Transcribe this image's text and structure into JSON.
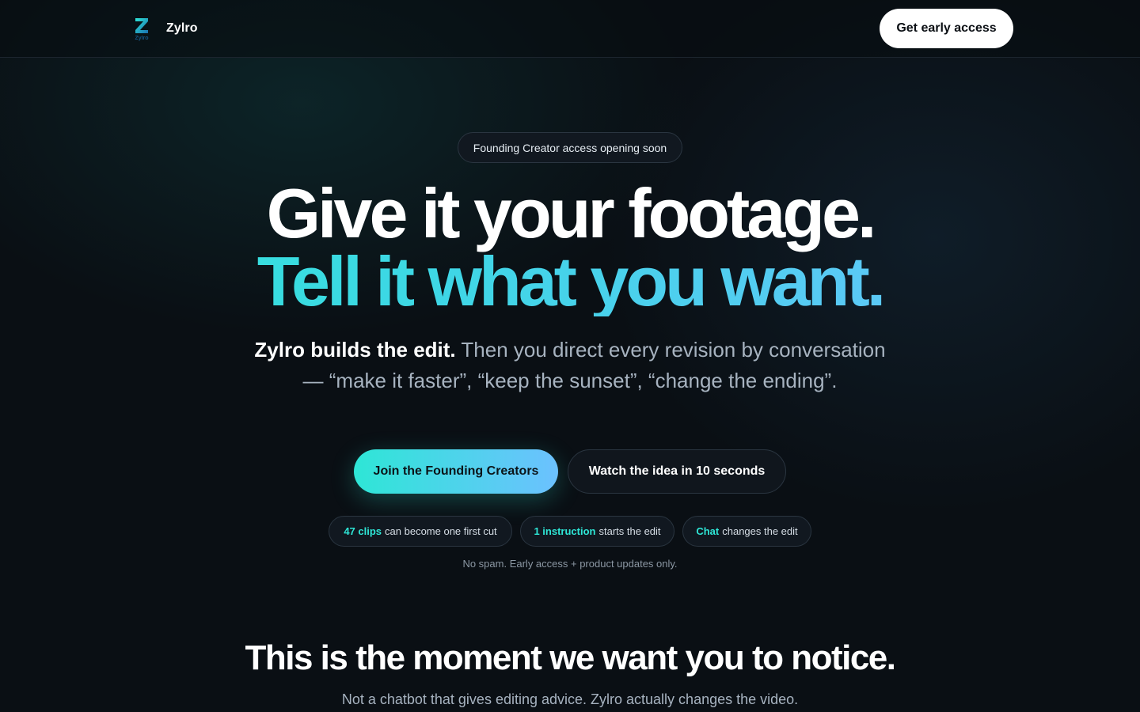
{
  "header": {
    "brand_name": "Zylro",
    "logo_letter": "Z",
    "logo_text": "Zylro",
    "cta_label": "Get early access"
  },
  "hero": {
    "badge": "Founding Creator access opening soon",
    "headline_line1": "Give it your footage.",
    "headline_line2": "Tell it what you want.",
    "lede_strong": "Zylro builds the edit.",
    "lede_rest": " Then you direct every revision by conversation — “make it faster”, “keep the sunset”, “change the ending”.",
    "primary_button": "Join the Founding Creators",
    "secondary_button": "Watch the idea in 10 seconds",
    "chips": [
      {
        "highlight": "47 clips",
        "text": "can become one first cut"
      },
      {
        "highlight": "1 instruction",
        "text": "starts the edit"
      },
      {
        "highlight": "Chat",
        "text": "changes the edit"
      }
    ],
    "note": "No spam. Early access + product updates only."
  },
  "section": {
    "title": "This is the moment we want you to notice.",
    "subtitle": "Not a chatbot that gives editing advice. Zylro actually changes the video."
  },
  "colors": {
    "background": "#0a0f14",
    "accent_start": "#2ee6d6",
    "accent_end": "#6cc1ff",
    "text_muted": "#a7b3c0"
  }
}
